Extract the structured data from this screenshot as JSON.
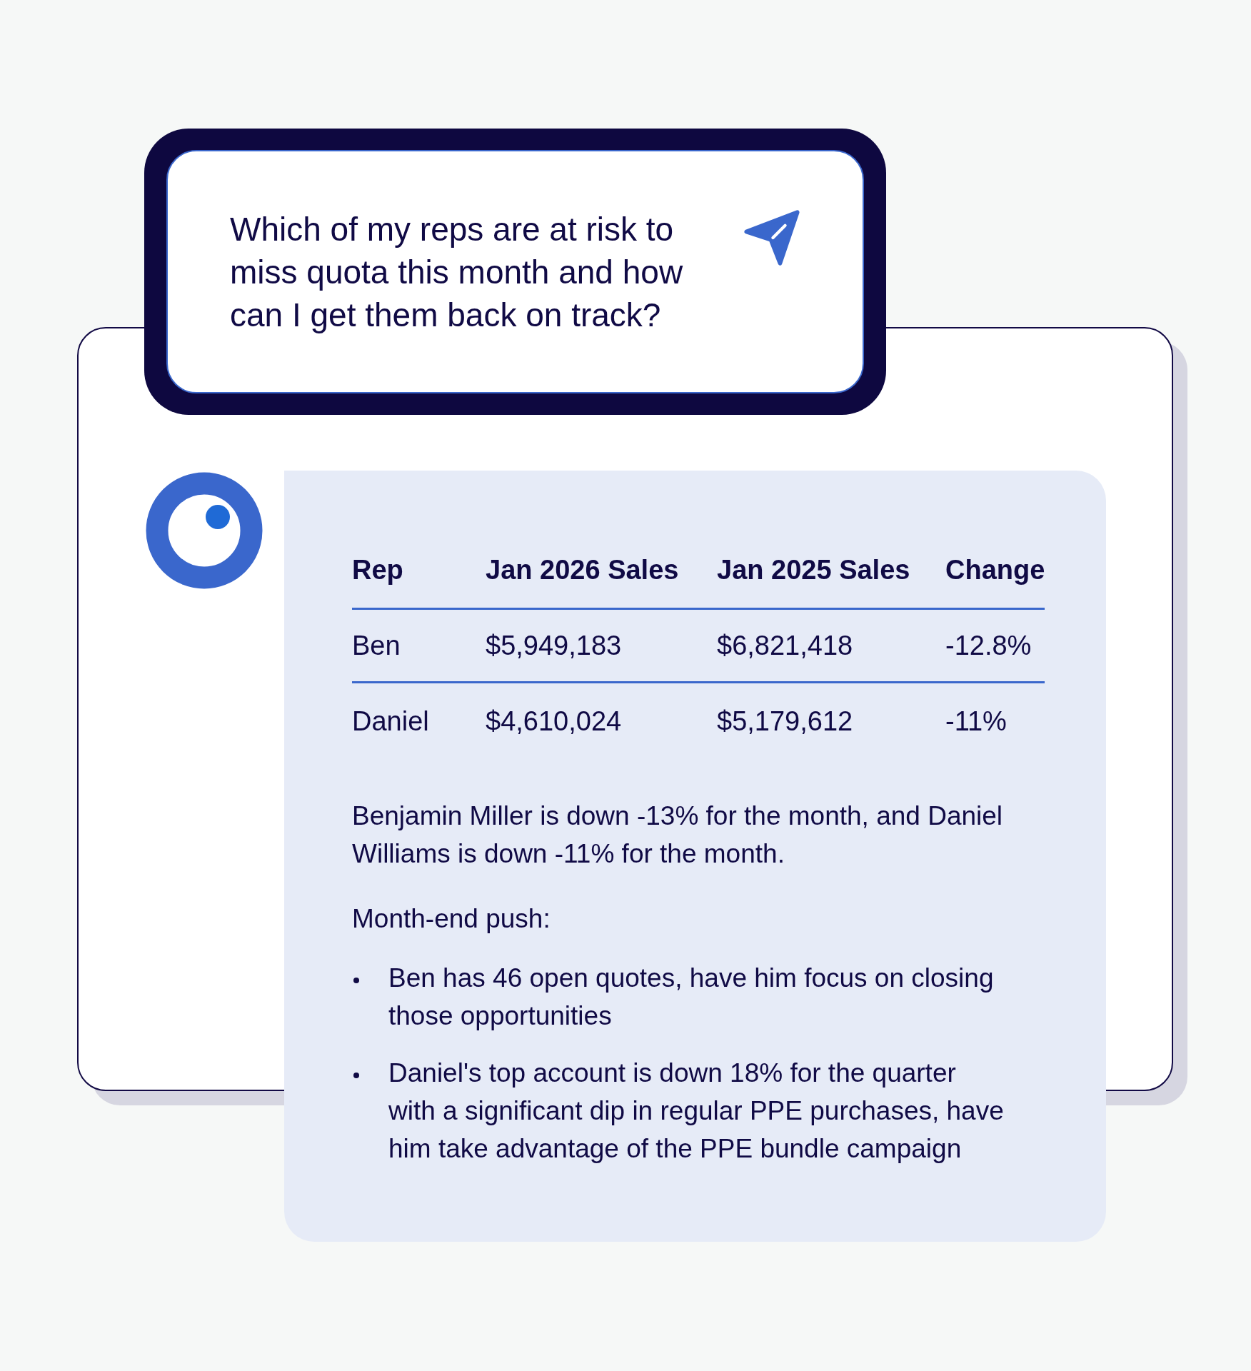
{
  "prompt": {
    "value": "Which of my reps are at risk to miss quota this month and how can I get them back on track?"
  },
  "answer": {
    "table": {
      "columns": [
        "Rep",
        "Jan 2026 Sales",
        "Jan 2025 Sales",
        "Change"
      ],
      "rows": [
        [
          "Ben",
          "$5,949,183",
          "$6,821,418",
          "-12.8%"
        ],
        [
          "Daniel",
          "$4,610,024",
          "$5,179,612",
          "-11%"
        ]
      ]
    },
    "summary": "Benjamin Miller is down -13% for the month, and Daniel Williams is down -11% for the month.",
    "list_title": "Month-end push:",
    "bullets": [
      "Ben has 46 open quotes, have him focus on closing those opportunities",
      "Daniel's top account is down 18% for the quarter with a significant dip in regular PPE purchases, have him take advantage of the PPE bundle campaign"
    ]
  }
}
